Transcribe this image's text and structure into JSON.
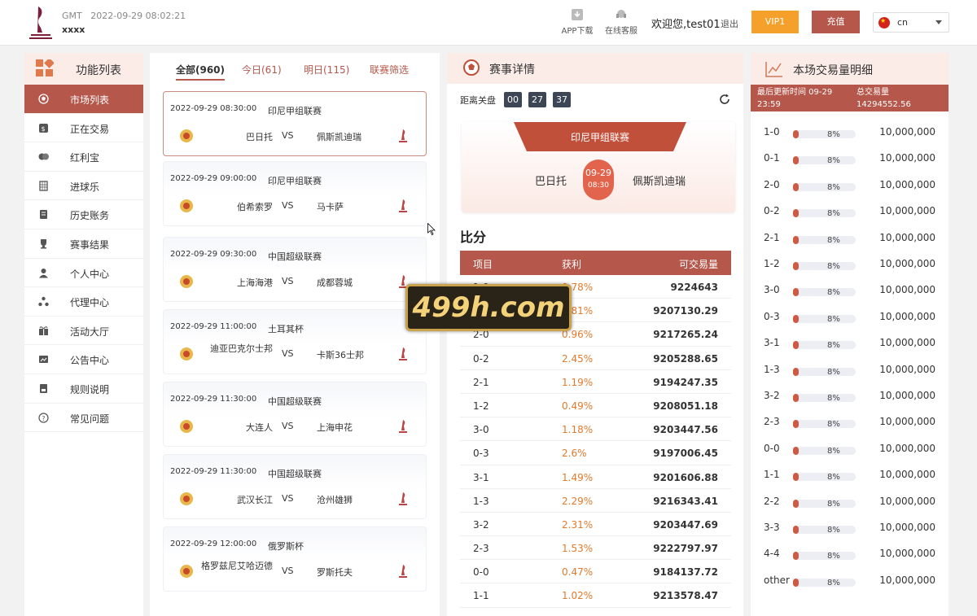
{
  "header": {
    "gmt_label": "GMT",
    "datetime": "2022-09-29 08:02:21",
    "username_masked": "xxxx",
    "app_download": "APP下载",
    "online_service": "在线客服",
    "welcome": "欢迎您,test01",
    "logout": "退出",
    "vip": "VIP1",
    "charge": "充值",
    "lang": "cn"
  },
  "sidebar": {
    "title": "功能列表",
    "items": [
      {
        "label": "市场列表",
        "icon": "soccer-ball-icon"
      },
      {
        "label": "正在交易",
        "icon": "trade-icon"
      },
      {
        "label": "红利宝",
        "icon": "coins-icon"
      },
      {
        "label": "进球乐",
        "icon": "goal-icon"
      },
      {
        "label": "历史账务",
        "icon": "history-icon"
      },
      {
        "label": "赛事结果",
        "icon": "trophy-icon"
      },
      {
        "label": "个人中心",
        "icon": "user-icon"
      },
      {
        "label": "代理中心",
        "icon": "agent-icon"
      },
      {
        "label": "活动大厅",
        "icon": "gift-icon"
      },
      {
        "label": "公告中心",
        "icon": "notice-icon"
      },
      {
        "label": "规则说明",
        "icon": "rules-icon"
      },
      {
        "label": "常见问题",
        "icon": "question-icon"
      }
    ]
  },
  "tabs": [
    "全部(960)",
    "今日(61)",
    "明日(115)",
    "联赛筛选"
  ],
  "matches": [
    {
      "time": "2022-09-29 08:30:00",
      "league": "印尼甲组联赛",
      "home": "巴日托",
      "vs": "VS",
      "away": "佩斯凯迪瑞"
    },
    {
      "time": "2022-09-29 09:00:00",
      "league": "印尼甲组联赛",
      "home": "伯希索罗",
      "vs": "VS",
      "away": "马卡萨"
    },
    {
      "time": "2022-09-29 09:30:00",
      "league": "中国超级联赛",
      "home": "上海海港",
      "vs": "VS",
      "away": "成都蓉城"
    },
    {
      "time": "2022-09-29 11:00:00",
      "league": "土耳其杯",
      "home": "迪亚巴克尔士邦",
      "vs": "VS",
      "away": "卡斯36士邦"
    },
    {
      "time": "2022-09-29 11:30:00",
      "league": "中国超级联赛",
      "home": "大连人",
      "vs": "VS",
      "away": "上海申花"
    },
    {
      "time": "2022-09-29 11:30:00",
      "league": "中国超级联赛",
      "home": "武汉长江",
      "vs": "VS",
      "away": "沧州雄狮"
    },
    {
      "time": "2022-09-29 12:00:00",
      "league": "俄罗斯杯",
      "home": "格罗兹尼艾哈迈德",
      "vs": "VS",
      "away": "罗斯托夫"
    }
  ],
  "detail": {
    "title": "赛事详情",
    "countdown_label": "距离关盘",
    "cd_h": "00",
    "cd_m": "27",
    "cd_s": "37",
    "league": "印尼甲组联赛",
    "home": "巴日托",
    "away": "佩斯凯迪瑞",
    "date": "09-29",
    "time": "08:30",
    "score_title": "比分",
    "col_item": "项目",
    "col_profit": "获利",
    "col_volume": "可交易量",
    "rows": [
      {
        "score": "1-0",
        "profit": "0.78%",
        "volume": "9224643"
      },
      {
        "score": "0-1",
        "profit": "0.81%",
        "volume": "9207130.29"
      },
      {
        "score": "2-0",
        "profit": "0.96%",
        "volume": "9217265.24"
      },
      {
        "score": "0-2",
        "profit": "2.45%",
        "volume": "9205288.65"
      },
      {
        "score": "2-1",
        "profit": "1.19%",
        "volume": "9194247.35"
      },
      {
        "score": "1-2",
        "profit": "0.49%",
        "volume": "9208051.18"
      },
      {
        "score": "3-0",
        "profit": "1.18%",
        "volume": "9203447.56"
      },
      {
        "score": "0-3",
        "profit": "2.6%",
        "volume": "9197006.45"
      },
      {
        "score": "3-1",
        "profit": "1.49%",
        "volume": "9201606.88"
      },
      {
        "score": "1-3",
        "profit": "2.29%",
        "volume": "9216343.41"
      },
      {
        "score": "3-2",
        "profit": "2.31%",
        "volume": "9203447.69"
      },
      {
        "score": "2-3",
        "profit": "1.53%",
        "volume": "9222797.97"
      },
      {
        "score": "0-0",
        "profit": "0.47%",
        "volume": "9184137.72"
      },
      {
        "score": "1-1",
        "profit": "1.02%",
        "volume": "9213578.47"
      }
    ]
  },
  "trade": {
    "title": "本场交易量明细",
    "last_update_label": "最后更新时间 09-29 23:59",
    "total_label": "总交易量",
    "total_value": "14294552.56",
    "rows": [
      {
        "score": "1-0",
        "pct": "8%",
        "fraction": 0.08,
        "amount": "10,000,000"
      },
      {
        "score": "0-1",
        "pct": "8%",
        "fraction": 0.08,
        "amount": "10,000,000"
      },
      {
        "score": "2-0",
        "pct": "8%",
        "fraction": 0.08,
        "amount": "10,000,000"
      },
      {
        "score": "0-2",
        "pct": "8%",
        "fraction": 0.08,
        "amount": "10,000,000"
      },
      {
        "score": "2-1",
        "pct": "8%",
        "fraction": 0.08,
        "amount": "10,000,000"
      },
      {
        "score": "1-2",
        "pct": "8%",
        "fraction": 0.08,
        "amount": "10,000,000"
      },
      {
        "score": "3-0",
        "pct": "8%",
        "fraction": 0.08,
        "amount": "10,000,000"
      },
      {
        "score": "0-3",
        "pct": "8%",
        "fraction": 0.08,
        "amount": "10,000,000"
      },
      {
        "score": "3-1",
        "pct": "8%",
        "fraction": 0.08,
        "amount": "10,000,000"
      },
      {
        "score": "1-3",
        "pct": "8%",
        "fraction": 0.08,
        "amount": "10,000,000"
      },
      {
        "score": "3-2",
        "pct": "8%",
        "fraction": 0.08,
        "amount": "10,000,000"
      },
      {
        "score": "2-3",
        "pct": "8%",
        "fraction": 0.08,
        "amount": "10,000,000"
      },
      {
        "score": "0-0",
        "pct": "8%",
        "fraction": 0.08,
        "amount": "10,000,000"
      },
      {
        "score": "1-1",
        "pct": "8%",
        "fraction": 0.08,
        "amount": "10,000,000"
      },
      {
        "score": "2-2",
        "pct": "8%",
        "fraction": 0.08,
        "amount": "10,000,000"
      },
      {
        "score": "3-3",
        "pct": "8%",
        "fraction": 0.08,
        "amount": "10,000,000"
      },
      {
        "score": "4-4",
        "pct": "8%",
        "fraction": 0.08,
        "amount": "10,000,000"
      },
      {
        "score": "other",
        "pct": "8%",
        "fraction": 0.08,
        "amount": "10,000,000"
      }
    ]
  },
  "watermark": "499h.com",
  "colors": {
    "accent": "#b5574a",
    "vip": "#f5a02a",
    "profit": "#e07a2c",
    "head_bg": "#fbece7"
  }
}
